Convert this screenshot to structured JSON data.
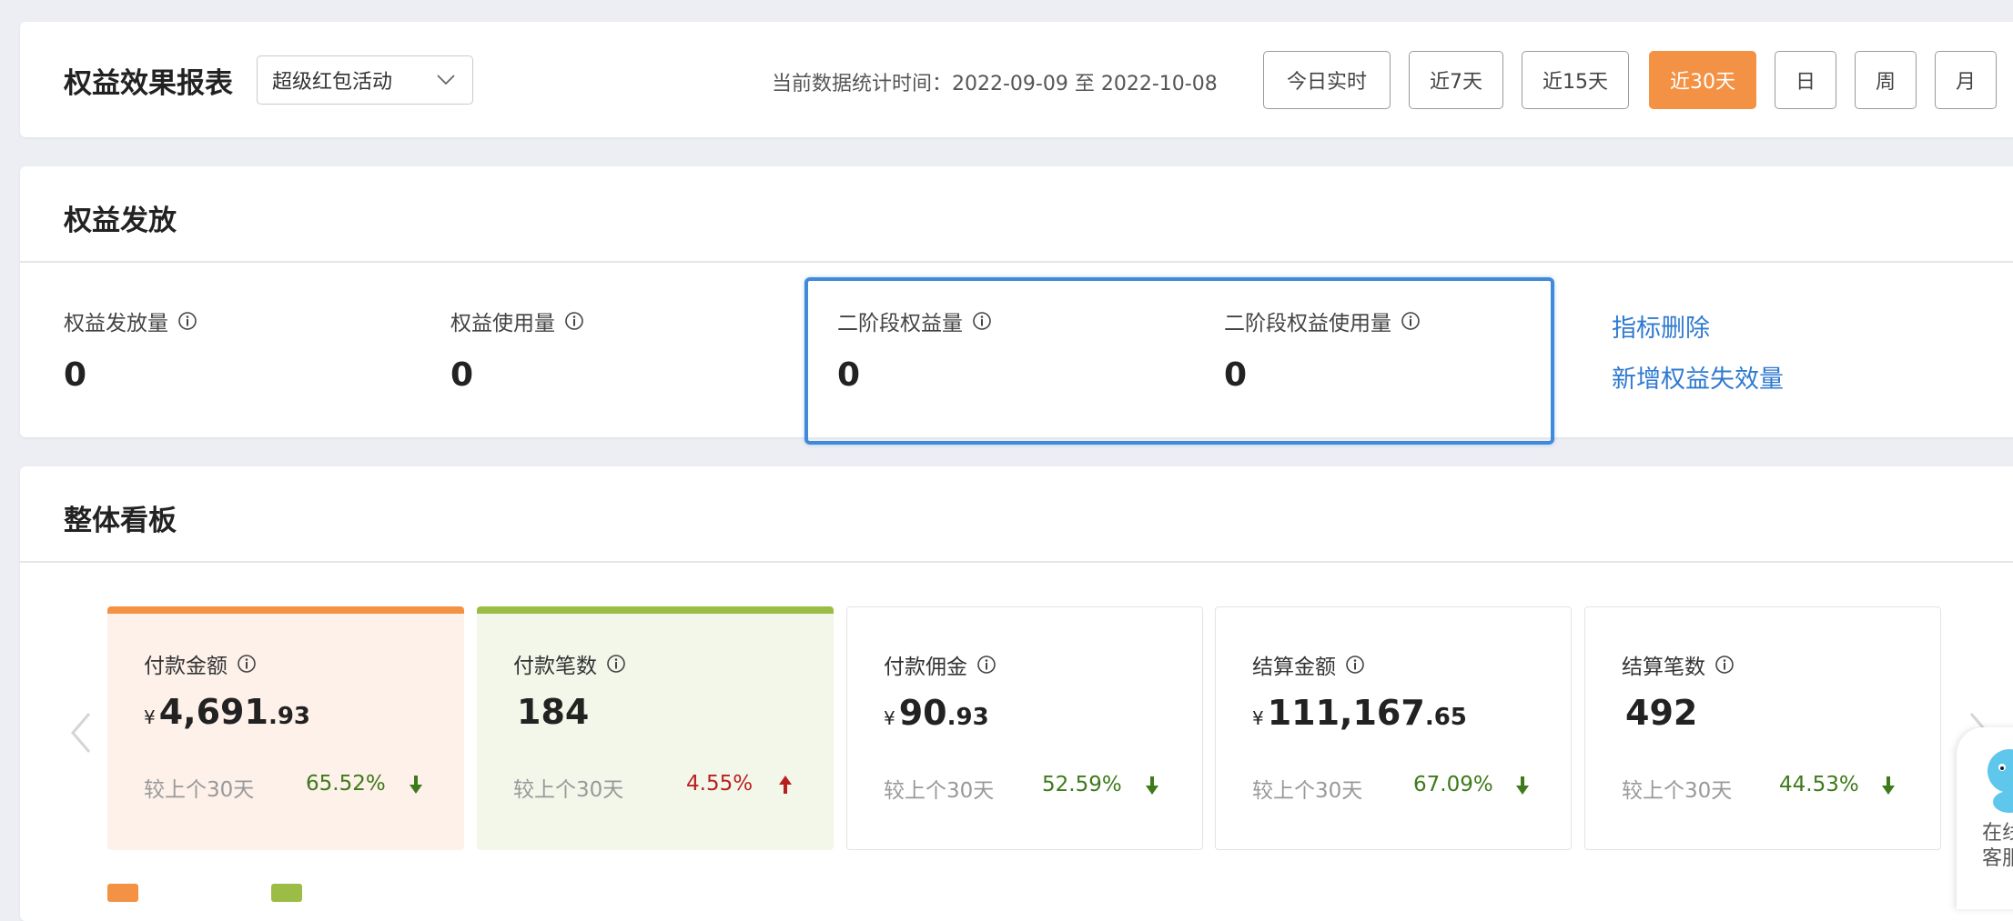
{
  "header": {
    "title": "权益效果报表",
    "activity_select": "超级红包活动",
    "date_range": "当前数据统计时间：2022-09-09 至 2022-10-08",
    "time_buttons": [
      "今日实时",
      "近7天",
      "近15天",
      "近30天",
      "日",
      "周",
      "月"
    ],
    "active_button": "近30天"
  },
  "rights": {
    "title": "权益发放",
    "metrics": [
      {
        "label": "权益发放量",
        "value": "0"
      },
      {
        "label": "权益使用量",
        "value": "0"
      },
      {
        "label": "二阶段权益量",
        "value": "0"
      },
      {
        "label": "二阶段权益使用量",
        "value": "0"
      }
    ],
    "links": [
      "指标删除",
      "新增权益失效量"
    ]
  },
  "board": {
    "title": "整体看板",
    "tiles": [
      {
        "label": "付款金额",
        "currency": "¥",
        "int": "4,691",
        "dec": ".93",
        "compare": "较上个30天",
        "pct": "65.52%",
        "trend": "down"
      },
      {
        "label": "付款笔数",
        "currency": "",
        "int": "184",
        "dec": "",
        "compare": "较上个30天",
        "pct": "4.55%",
        "trend": "up"
      },
      {
        "label": "付款佣金",
        "currency": "¥",
        "int": "90",
        "dec": ".93",
        "compare": "较上个30天",
        "pct": "52.59%",
        "trend": "down"
      },
      {
        "label": "结算金额",
        "currency": "¥",
        "int": "111,167",
        "dec": ".65",
        "compare": "较上个30天",
        "pct": "67.09%",
        "trend": "down"
      },
      {
        "label": "结算笔数",
        "currency": "",
        "int": "492",
        "dec": "",
        "compare": "较上个30天",
        "pct": "44.53%",
        "trend": "down"
      }
    ]
  },
  "chat_widget": {
    "line1": "在线",
    "line2": "客服"
  },
  "colors": {
    "accent_orange": "#f39244",
    "accent_green": "#9bbd45",
    "link_blue": "#2f7ad0",
    "highlight_blue": "#3f8ad9",
    "trend_down_green": "#3d7a1a",
    "trend_up_red": "#b8201f"
  }
}
